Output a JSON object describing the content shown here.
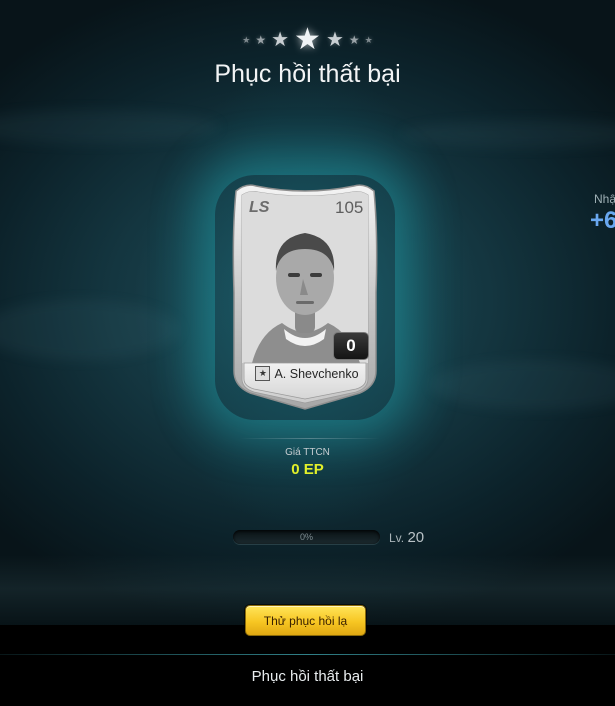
{
  "header": {
    "stars": [
      "small-star",
      "small-star",
      "medium-star",
      "large-star",
      "medium-star",
      "small-star",
      "small-star"
    ],
    "title": "Phục hồi thất bại"
  },
  "side_panel": {
    "label": "Nhậ",
    "value": "+6"
  },
  "player_card": {
    "position": "LS",
    "overall": "105",
    "enhance_level": "0",
    "name": "A. Shevchenko",
    "name_icon": "star-icon",
    "photo": "grayscale-portrait"
  },
  "price": {
    "label": "Giá TTCN",
    "value": "0 EP"
  },
  "progress": {
    "fraction": 0,
    "text": "0%",
    "level_prefix": "Lv.",
    "level_value": "20"
  },
  "actions": {
    "retry_label": "Thử phục hồi lạ"
  },
  "footer": {
    "text": "Phục hồi thất bại"
  },
  "colors": {
    "glow": "#28c8d2",
    "price_value": "#e2f02a",
    "button": "#f7c622",
    "side_value": "#6aa8f0"
  }
}
